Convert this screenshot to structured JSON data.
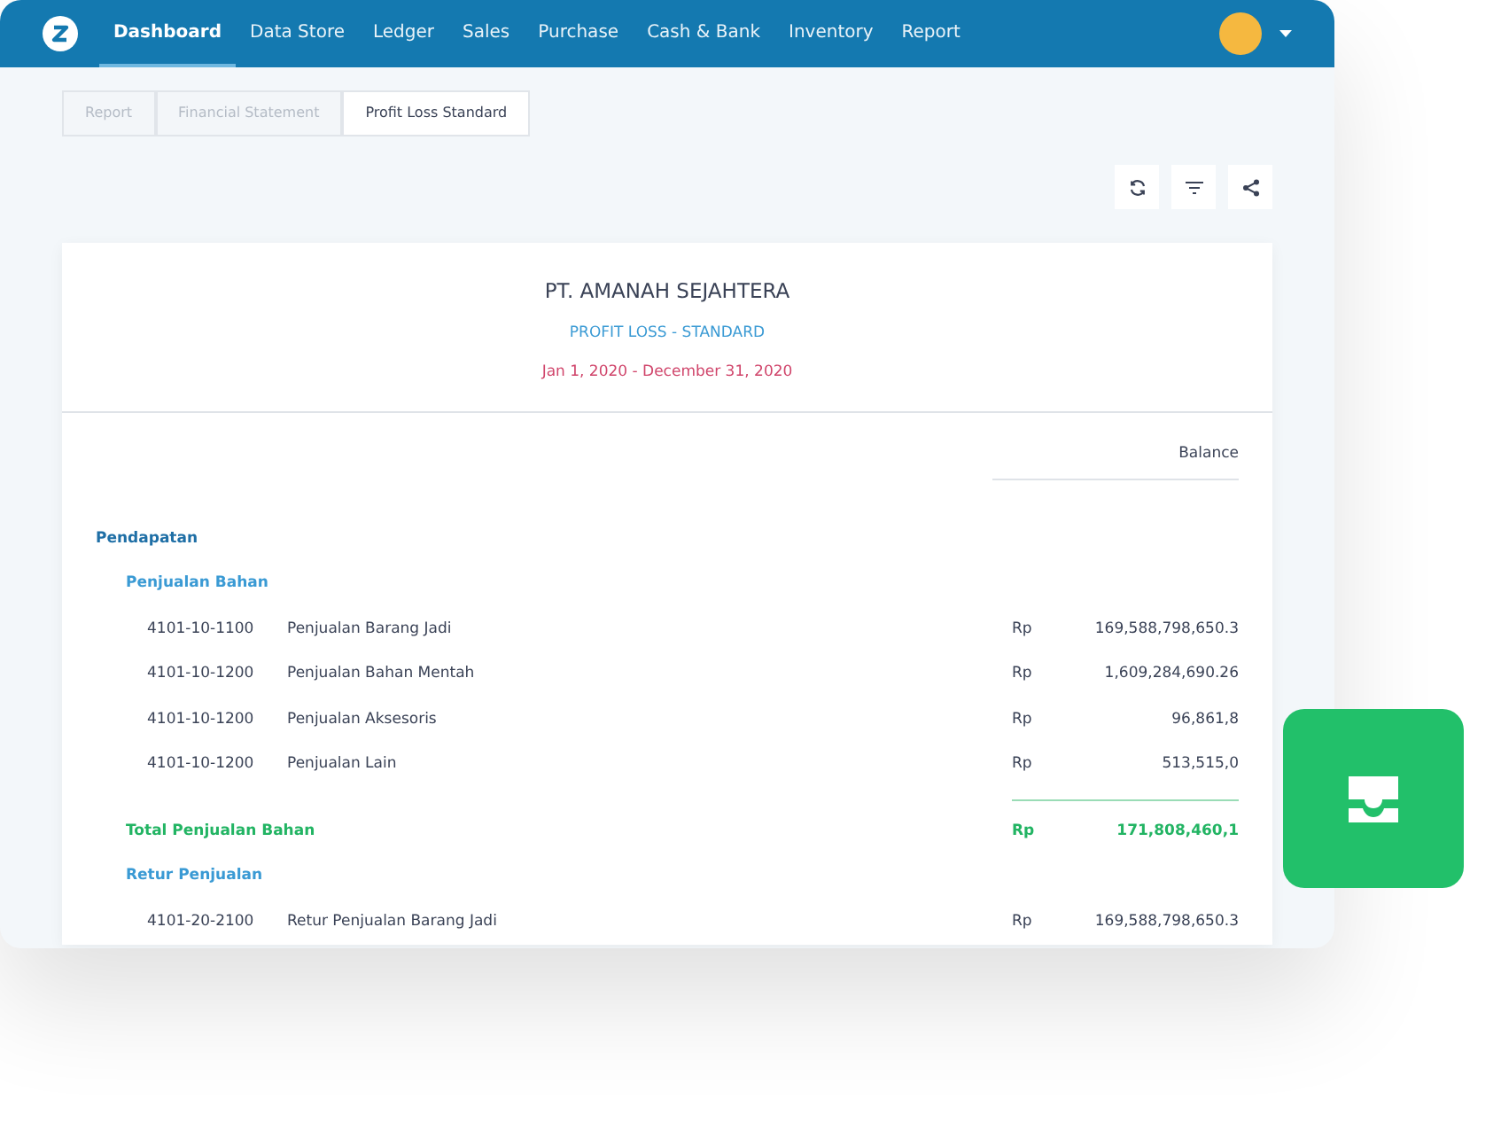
{
  "nav": {
    "items": [
      {
        "label": "Dashboard",
        "selected": true
      },
      {
        "label": "Data Store",
        "selected": false
      },
      {
        "label": "Ledger",
        "selected": false
      },
      {
        "label": "Sales",
        "selected": false
      },
      {
        "label": "Purchase",
        "selected": false
      },
      {
        "label": "Cash & Bank",
        "selected": false
      },
      {
        "label": "Inventory",
        "selected": false
      },
      {
        "label": "Report",
        "selected": false
      }
    ]
  },
  "breadcrumb": [
    {
      "label": "Report",
      "selected": false
    },
    {
      "label": "Financial Statement",
      "selected": false
    },
    {
      "label": "Profit Loss Standard",
      "selected": true
    }
  ],
  "report": {
    "company": "PT. AMANAH SEJAHTERA",
    "title": "PROFIT LOSS - STANDARD",
    "period": "Jan 1, 2020 - December 31, 2020",
    "balance_header": "Balance",
    "rows": [
      {
        "kind": "section",
        "label": "Pendapatan"
      },
      {
        "kind": "group",
        "label": "Penjualan Bahan"
      },
      {
        "kind": "line",
        "code": "4101-10-1100",
        "name": "Penjualan Barang Jadi",
        "currency": "Rp",
        "amount": "169,588,798,650.3"
      },
      {
        "kind": "line",
        "code": "4101-10-1200",
        "name": "Penjualan Bahan Mentah",
        "currency": "Rp",
        "amount": "1,609,284,690.26"
      },
      {
        "kind": "line",
        "code": "4101-10-1200",
        "name": "Penjualan Aksesoris",
        "currency": "Rp",
        "amount": "96,861,8"
      },
      {
        "kind": "line",
        "code": "4101-10-1200",
        "name": "Penjualan Lain",
        "currency": "Rp",
        "amount": "513,515,0"
      },
      {
        "kind": "total",
        "label": "Total Penjualan Bahan",
        "currency": "Rp",
        "amount": "171,808,460,1"
      },
      {
        "kind": "group",
        "label": "Retur Penjualan"
      },
      {
        "kind": "line",
        "code": "4101-20-2100",
        "name": "Retur Penjualan Barang Jadi",
        "currency": "Rp",
        "amount": "169,588,798,650.3"
      }
    ]
  }
}
